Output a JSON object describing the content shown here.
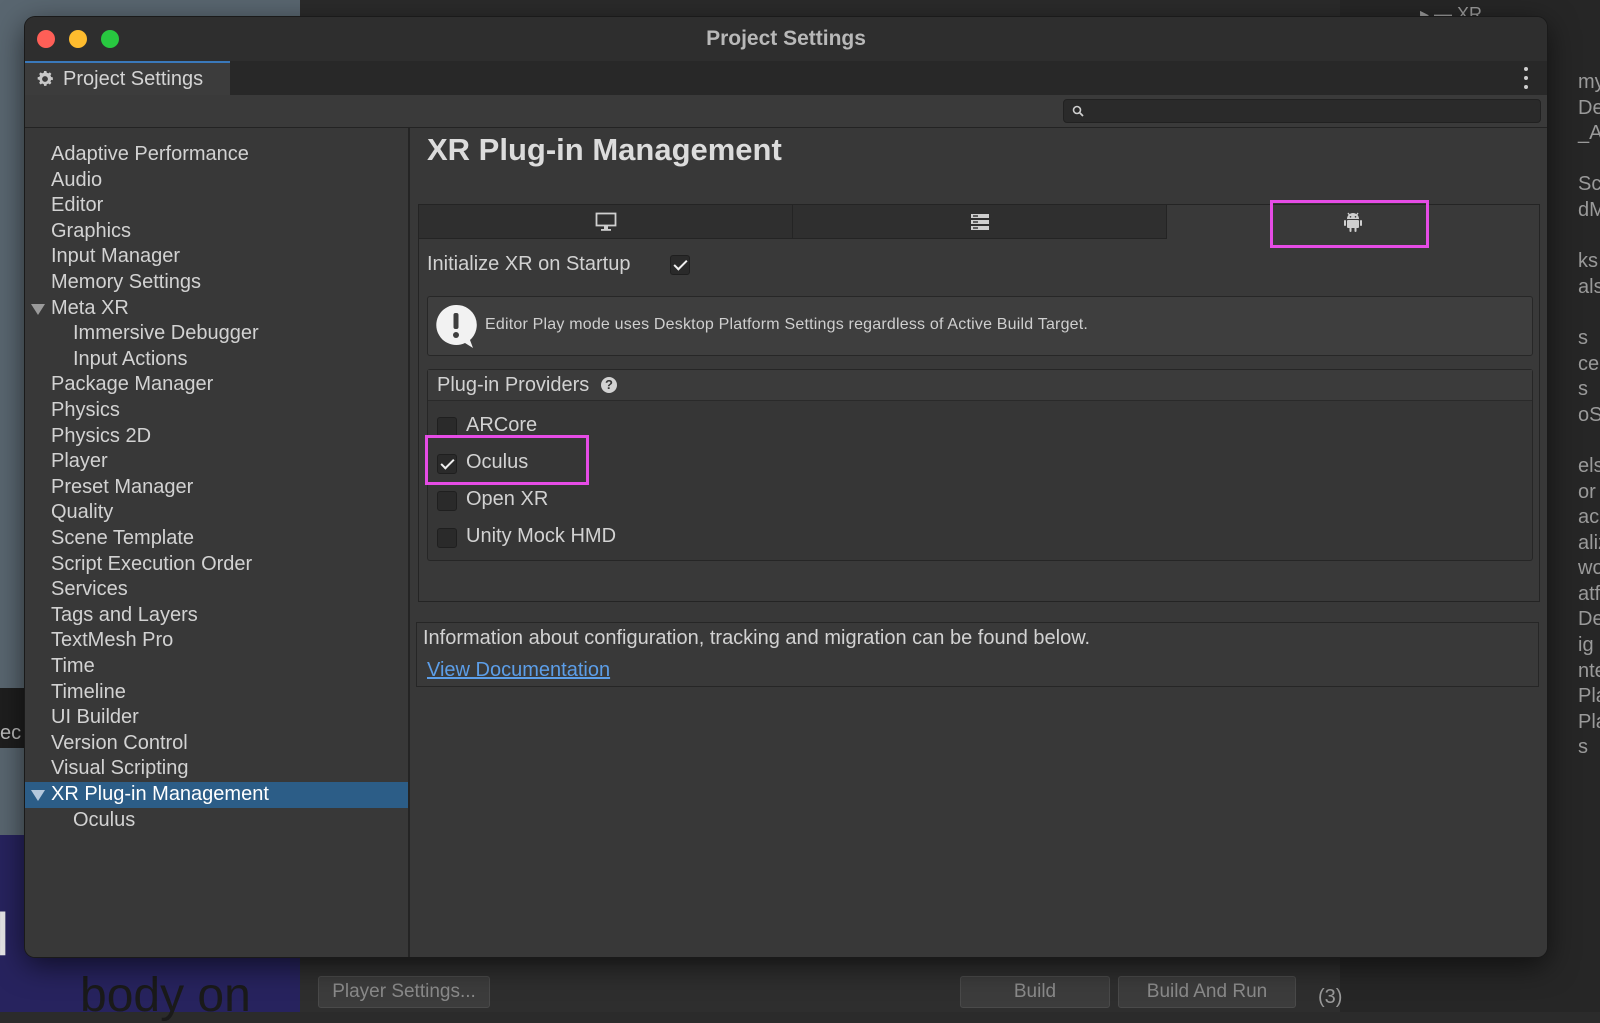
{
  "window": {
    "title": "Project Settings"
  },
  "tab": {
    "label": "Project Settings"
  },
  "search": {
    "placeholder": ""
  },
  "sidebar": {
    "items": [
      {
        "label": "Adaptive Performance",
        "indent": 0
      },
      {
        "label": "Audio",
        "indent": 0
      },
      {
        "label": "Editor",
        "indent": 0
      },
      {
        "label": "Graphics",
        "indent": 0
      },
      {
        "label": "Input Manager",
        "indent": 0
      },
      {
        "label": "Memory Settings",
        "indent": 0
      },
      {
        "label": "Meta XR",
        "indent": 0,
        "expanded": true
      },
      {
        "label": "Immersive Debugger",
        "indent": 1
      },
      {
        "label": "Input Actions",
        "indent": 1
      },
      {
        "label": "Package Manager",
        "indent": 0
      },
      {
        "label": "Physics",
        "indent": 0
      },
      {
        "label": "Physics 2D",
        "indent": 0
      },
      {
        "label": "Player",
        "indent": 0
      },
      {
        "label": "Preset Manager",
        "indent": 0
      },
      {
        "label": "Quality",
        "indent": 0
      },
      {
        "label": "Scene Template",
        "indent": 0
      },
      {
        "label": "Script Execution Order",
        "indent": 0
      },
      {
        "label": "Services",
        "indent": 0
      },
      {
        "label": "Tags and Layers",
        "indent": 0
      },
      {
        "label": "TextMesh Pro",
        "indent": 0
      },
      {
        "label": "Time",
        "indent": 0
      },
      {
        "label": "Timeline",
        "indent": 0
      },
      {
        "label": "UI Builder",
        "indent": 0
      },
      {
        "label": "Version Control",
        "indent": 0
      },
      {
        "label": "Visual Scripting",
        "indent": 0
      },
      {
        "label": "XR Plug-in Management",
        "indent": 0,
        "expanded": true,
        "selected": true
      },
      {
        "label": "Oculus",
        "indent": 1
      }
    ]
  },
  "main": {
    "heading": "XR Plug-in Management",
    "platform_tabs": [
      {
        "icon": "monitor-icon",
        "active": false
      },
      {
        "icon": "server-icon",
        "active": false
      },
      {
        "icon": "android-icon",
        "active": true,
        "highlighted": true
      }
    ],
    "init_label": "Initialize XR on Startup",
    "init_checked": true,
    "help_message": "Editor Play mode uses Desktop Platform Settings regardless of Active Build Target.",
    "providers_header": "Plug-in Providers",
    "providers": [
      {
        "label": "ARCore",
        "checked": false
      },
      {
        "label": "Oculus",
        "checked": true,
        "highlighted": true
      },
      {
        "label": "Open XR",
        "checked": false
      },
      {
        "label": "Unity Mock HMD",
        "checked": false
      }
    ],
    "info_text": "Information about configuration, tracking and migration can be found below.",
    "doc_link": "View Documentation"
  },
  "background": {
    "player_settings_button": "Player Settings...",
    "build_button": "Build",
    "build_and_run_button": "Build And Run",
    "folder_label": "XR",
    "counter": "(3)",
    "big_text": "body on",
    "side_fragment": "ec"
  },
  "colors": {
    "highlight": "#e64ce6",
    "selection": "#2c5d87",
    "link": "#5c9ee8",
    "close": "#fe5f57",
    "minimize": "#febc2e",
    "maximize": "#28c840"
  }
}
